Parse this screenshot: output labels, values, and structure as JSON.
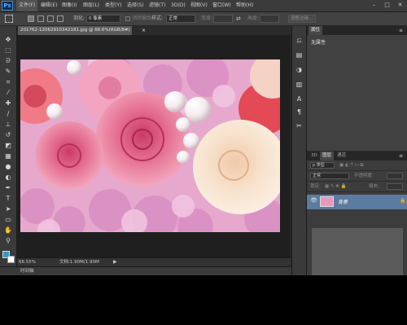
{
  "app": {
    "logo": "Ps"
  },
  "menu": [
    "文件(F)",
    "编辑(E)",
    "图像(I)",
    "图层(L)",
    "类型(Y)",
    "选择(S)",
    "滤镜(T)",
    "3D(D)",
    "视图(V)",
    "窗口(W)",
    "帮助(H)"
  ],
  "window_controls": {
    "minimize": "–",
    "maximize": "□",
    "close": "✕"
  },
  "options": {
    "feather_label": "羽化:",
    "feather_value": "0 像素",
    "antialias_label": "消除锯齿",
    "style_label": "样式:",
    "style_value": "正常",
    "width_label": "宽度:",
    "height_label": "高度:",
    "refine_edge": "调整边缘..."
  },
  "document": {
    "tab_title": "201762-12062910342181.jpg @ 66.6%(RGB/8#)",
    "tab_close": "×",
    "zoom": "66.55%",
    "doc_info": "文档:1.90M/1.90M"
  },
  "timeline": {
    "label": "时间轴"
  },
  "properties": {
    "tab": "属性",
    "title": "无属性"
  },
  "layers": {
    "tabs": [
      "3D",
      "图层",
      "通道"
    ],
    "kind_filter": "p 类型",
    "blend_mode": "正常",
    "opacity_label": "不透明度:",
    "lock_label": "锁定:",
    "fill_label": "填充:",
    "layer_name": "背景"
  },
  "colors": {
    "foreground": "#2e98c9",
    "background": "#ffffff",
    "layer_selected": "#5b7ba0"
  },
  "icons": {
    "tools": [
      "move-icon",
      "marquee-icon",
      "lasso-icon",
      "quick-select-icon",
      "crop-icon",
      "eyedropper-icon",
      "healing-icon",
      "brush-icon",
      "stamp-icon",
      "history-brush-icon",
      "eraser-icon",
      "gradient-icon",
      "blur-icon",
      "dodge-icon",
      "pen-icon",
      "type-icon",
      "path-select-icon",
      "shape-icon",
      "hand-icon",
      "zoom-icon"
    ],
    "dock": [
      "history-icon",
      "properties-icon",
      "adjust-icon",
      "character-icon",
      "paragraph-icon",
      "tools-preset-icon"
    ]
  }
}
